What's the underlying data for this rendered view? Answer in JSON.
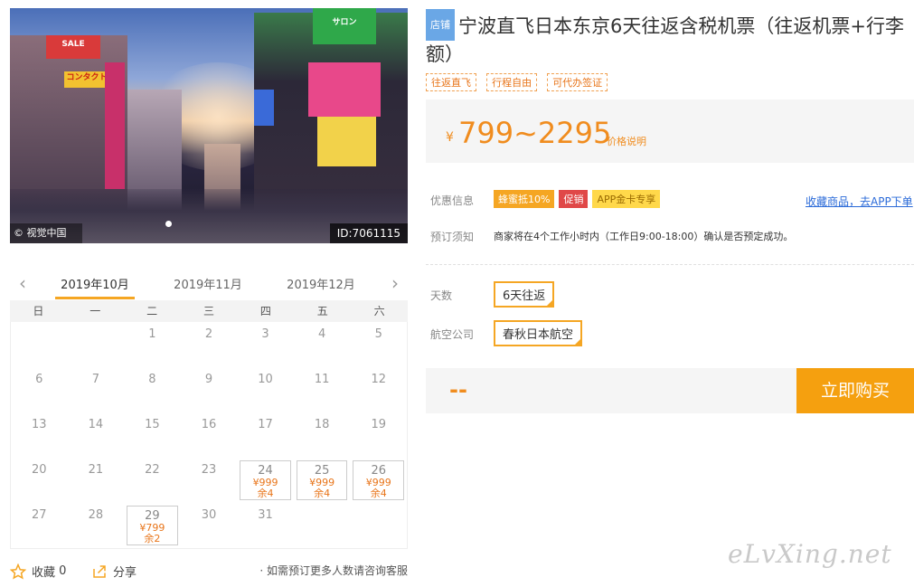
{
  "hero": {
    "credit": "© 视觉中国",
    "image_id": "ID:7061115"
  },
  "calendar": {
    "months": [
      "2019年10月",
      "2019年11月",
      "2019年12月"
    ],
    "active_month": "2019年10月",
    "weekdays": [
      "日",
      "一",
      "二",
      "三",
      "四",
      "五",
      "六"
    ],
    "days": [
      {
        "d": ""
      },
      {
        "d": ""
      },
      {
        "d": "1"
      },
      {
        "d": "2"
      },
      {
        "d": "3"
      },
      {
        "d": "4"
      },
      {
        "d": "5"
      },
      {
        "d": "6"
      },
      {
        "d": "7"
      },
      {
        "d": "8"
      },
      {
        "d": "9"
      },
      {
        "d": "10"
      },
      {
        "d": "11"
      },
      {
        "d": "12"
      },
      {
        "d": "13"
      },
      {
        "d": "14"
      },
      {
        "d": "15"
      },
      {
        "d": "16"
      },
      {
        "d": "17"
      },
      {
        "d": "18"
      },
      {
        "d": "19"
      },
      {
        "d": "20"
      },
      {
        "d": "21"
      },
      {
        "d": "22"
      },
      {
        "d": "23"
      },
      {
        "d": "24",
        "price": "¥999",
        "left": "余4"
      },
      {
        "d": "25",
        "price": "¥999",
        "left": "余4"
      },
      {
        "d": "26",
        "price": "¥999",
        "left": "余4"
      },
      {
        "d": "27"
      },
      {
        "d": "28"
      },
      {
        "d": "29",
        "price": "¥799",
        "left": "余2"
      },
      {
        "d": "30"
      },
      {
        "d": "31"
      }
    ]
  },
  "actions": {
    "favorite_label": "收藏",
    "favorite_count": "0",
    "share_label": "分享",
    "note": "· 如需预订更多人数请咨询客服"
  },
  "product": {
    "shop_tag": "店铺",
    "title": "宁波直飞日本东京6天往返含税机票（往返机票+行李额）",
    "tags": [
      "往返直飞",
      "行程自由",
      "可代办签证"
    ],
    "price_symbol": "¥",
    "price_range": "799~2295",
    "price_explain": "价格说明"
  },
  "promo": {
    "label": "优惠信息",
    "badges": [
      "蜂蜜抵10%",
      "促销",
      "APP金卡专享"
    ],
    "app_link": "收藏商品，去APP下单"
  },
  "booking": {
    "label": "预订须知",
    "text": "商家将在4个工作小时内（工作日9:00-18:00）确认是否预定成功。"
  },
  "options": {
    "days_label": "天数",
    "days_value": "6天往返",
    "airline_label": "航空公司",
    "airline_value": "春秋日本航空"
  },
  "buy": {
    "placeholder_price": "--",
    "button": "立即购买"
  },
  "watermark": "eLvXing.net",
  "colors": {
    "accent": "#f5a623",
    "price": "#f08c1e",
    "link": "#2a6ad8"
  }
}
